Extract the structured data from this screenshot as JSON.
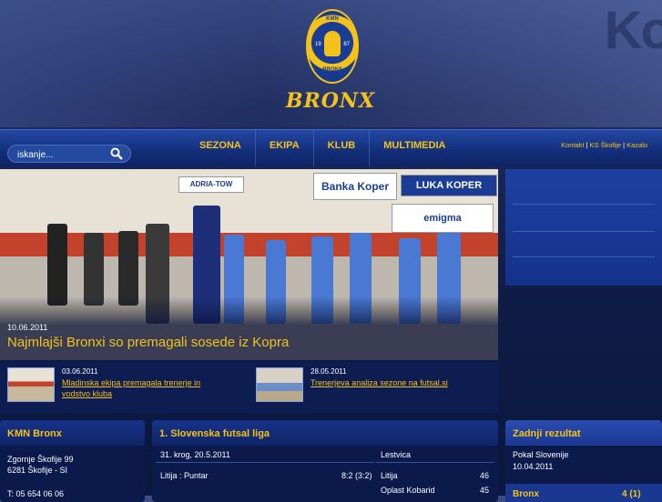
{
  "header": {
    "brand": "BRONX",
    "emblem_top": "KMN",
    "emblem_year_left": "19",
    "emblem_year_right": "87",
    "emblem_bottom": "BRONX"
  },
  "search": {
    "placeholder": "iskanje..."
  },
  "nav": {
    "items": [
      "SEZONA",
      "EKIPA",
      "KLUB",
      "MULTIMEDIA"
    ]
  },
  "toplinks": [
    "Kontakt",
    "KS Škofije",
    "Kazalo"
  ],
  "hero": {
    "date": "10.06.2011",
    "title": "Najmlajši Bronxi so premagali sosede iz Kopra",
    "signs": [
      "ADRIA-TOW",
      "Banka Koper",
      "LUKA KOPER",
      "emigma"
    ]
  },
  "news": [
    {
      "date": "03.06.2011",
      "title": "Mladinska ekipa premagala trenerje in vodstvo kluba"
    },
    {
      "date": "28.05.2011",
      "title": "Trenerjeva analiza sezone na futsal.si"
    }
  ],
  "club": {
    "title": "KMN Bronx",
    "address1": "Zgornje Škofije 99",
    "address2": "6281 Škofije - SI",
    "phone": "T: 05 654 06 06"
  },
  "league": {
    "title": "1. Slovenska futsal liga",
    "round": "31. krog, 20.5.2011",
    "match": "Litija : Puntar",
    "score": "8:2 (3:2)",
    "table_title": "Lestvica",
    "table": [
      {
        "team": "Litija",
        "points": "46"
      },
      {
        "team": "Oplast Kobarid",
        "points": "45"
      }
    ]
  },
  "last_result": {
    "title": "Zadnji rezultat",
    "competition": "Pokal Slovenije",
    "date": "10.04.2011",
    "team": "Bronx",
    "score": "4 (1)"
  },
  "colors": {
    "accent": "#f4c21a",
    "nav": "#14307c",
    "panel": "#0b1a4b"
  }
}
